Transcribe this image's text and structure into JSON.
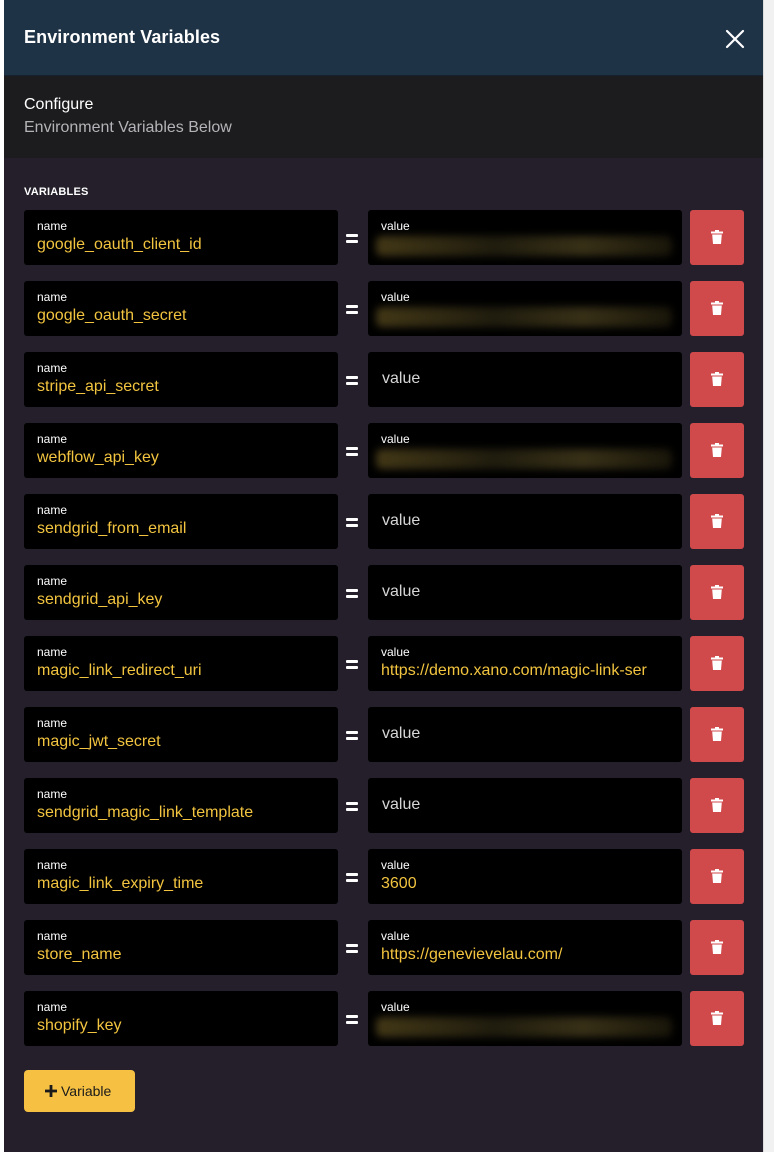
{
  "header": {
    "title": "Environment Variables",
    "close_icon": "close-icon"
  },
  "subheader": {
    "title": "Configure",
    "description": "Environment Variables Below"
  },
  "section_label": "VARIABLES",
  "field_labels": {
    "name": "name",
    "value": "value"
  },
  "value_placeholder": "value",
  "variables": [
    {
      "name": "google_oauth_client_id",
      "value": "",
      "state": "masked"
    },
    {
      "name": "google_oauth_secret",
      "value": "",
      "state": "masked"
    },
    {
      "name": "stripe_api_secret",
      "value": "",
      "state": "empty"
    },
    {
      "name": "webflow_api_key",
      "value": "",
      "state": "masked"
    },
    {
      "name": "sendgrid_from_email",
      "value": "",
      "state": "empty"
    },
    {
      "name": "sendgrid_api_key",
      "value": "",
      "state": "empty"
    },
    {
      "name": "magic_link_redirect_uri",
      "value": "https://demo.xano.com/magic-link-ser",
      "state": "filled"
    },
    {
      "name": "magic_jwt_secret",
      "value": "",
      "state": "empty"
    },
    {
      "name": "sendgrid_magic_link_template",
      "value": "",
      "state": "empty"
    },
    {
      "name": "magic_link_expiry_time",
      "value": "3600",
      "state": "filled"
    },
    {
      "name": "store_name",
      "value": "https://genevievelau.com/",
      "state": "filled"
    },
    {
      "name": "shopify_key",
      "value": "",
      "state": "masked"
    }
  ],
  "add_button": {
    "label": "Variable",
    "icon": "plus-icon"
  },
  "colors": {
    "header_bg": "#1f3347",
    "panel_bg": "#241f2a",
    "field_bg": "#000000",
    "name_text": "#f2c43f",
    "delete_bg": "#d0494b",
    "add_bg": "#f6c143"
  }
}
